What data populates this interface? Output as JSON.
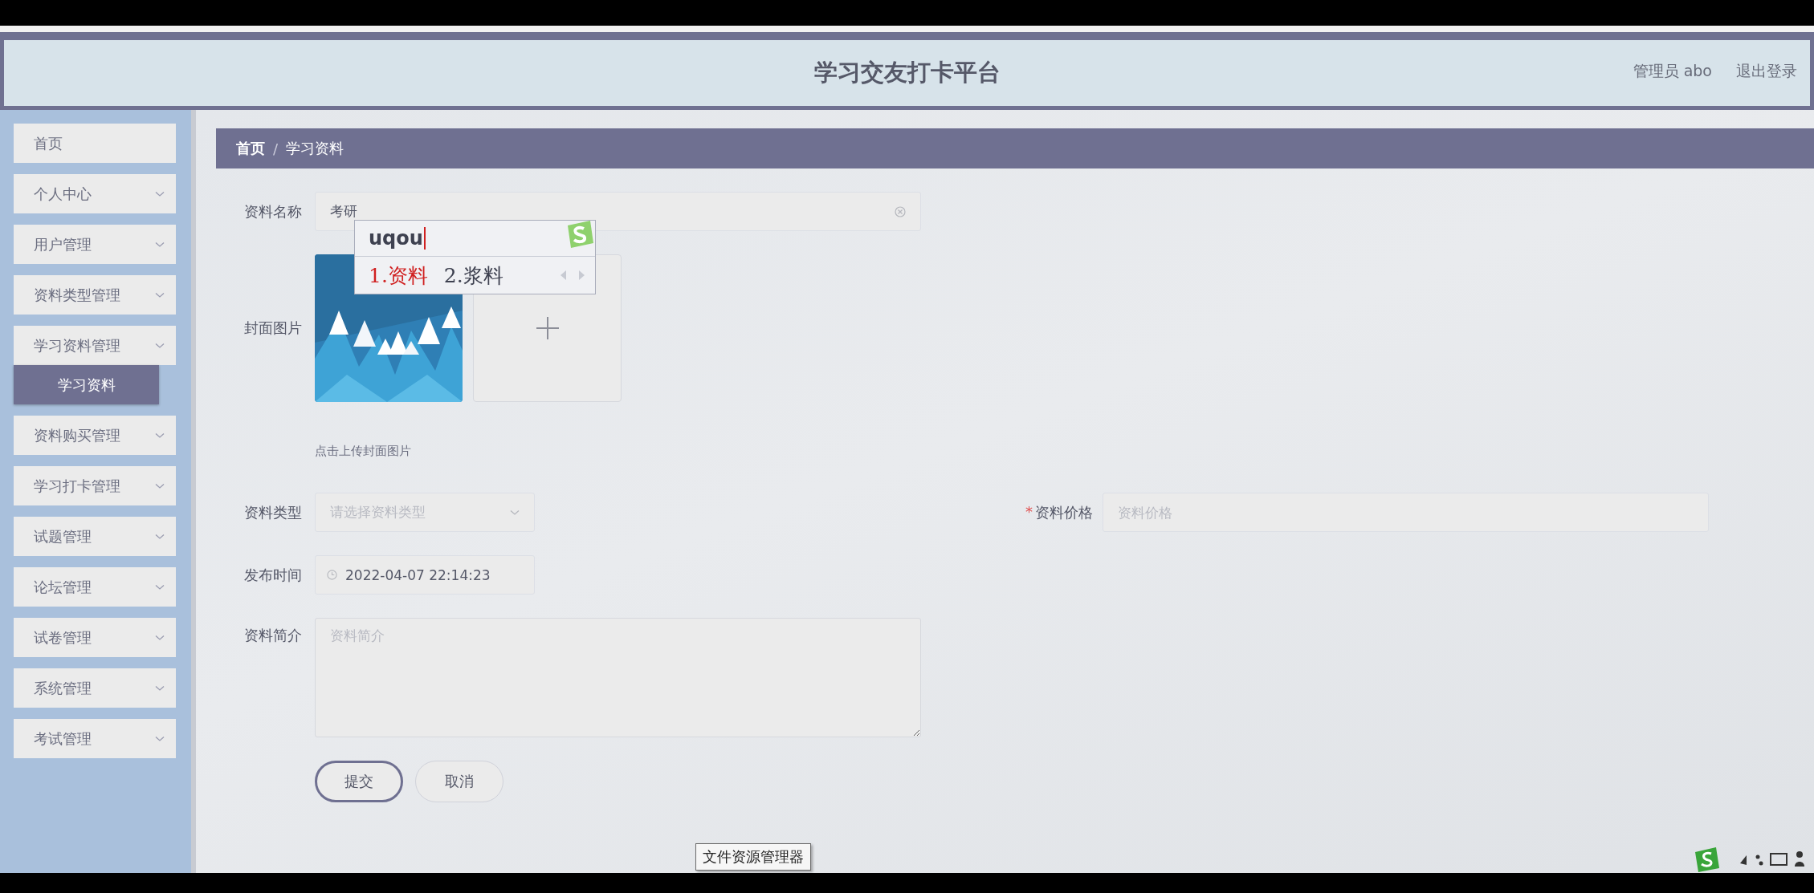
{
  "header": {
    "title": "学习交友打卡平台",
    "user": "管理员 abo",
    "logout": "退出登录"
  },
  "sidebar": {
    "items": [
      {
        "label": "首页",
        "kind": "link"
      },
      {
        "label": "个人中心",
        "kind": "submenu"
      },
      {
        "label": "用户管理",
        "kind": "submenu"
      },
      {
        "label": "资料类型管理",
        "kind": "submenu"
      },
      {
        "label": "学习资料管理",
        "kind": "submenu",
        "children": [
          {
            "label": "学习资料",
            "selected": true
          }
        ]
      },
      {
        "label": "资料购买管理",
        "kind": "submenu"
      },
      {
        "label": "学习打卡管理",
        "kind": "submenu"
      },
      {
        "label": "试题管理",
        "kind": "submenu"
      },
      {
        "label": "论坛管理",
        "kind": "submenu"
      },
      {
        "label": "试卷管理",
        "kind": "submenu"
      },
      {
        "label": "系统管理",
        "kind": "submenu"
      },
      {
        "label": "考试管理",
        "kind": "submenu"
      }
    ]
  },
  "breadcrumb": {
    "items": [
      "首页",
      "学习资料"
    ],
    "separator": "/"
  },
  "form": {
    "name": {
      "label": "资料名称",
      "value": "考研"
    },
    "cover": {
      "label": "封面图片",
      "hint": "点击上传封面图片"
    },
    "type": {
      "label": "资料类型",
      "placeholder": "请选择资料类型"
    },
    "price": {
      "label": "资料价格",
      "required_mark": "*",
      "placeholder": "资料价格"
    },
    "time": {
      "label": "发布时间",
      "value": "2022-04-07 22:14:23"
    },
    "intro": {
      "label": "资料简介",
      "placeholder": "资料简介"
    },
    "buttons": [
      {
        "label": "提交",
        "kind": "primary"
      },
      {
        "label": "取消",
        "kind": "default"
      }
    ]
  },
  "ime": {
    "composition": "uqou",
    "candidates": [
      {
        "label": "1.资料",
        "selected": true
      },
      {
        "label": "2.浆料",
        "selected": false
      }
    ]
  },
  "tooltip": "文件资源管理器"
}
